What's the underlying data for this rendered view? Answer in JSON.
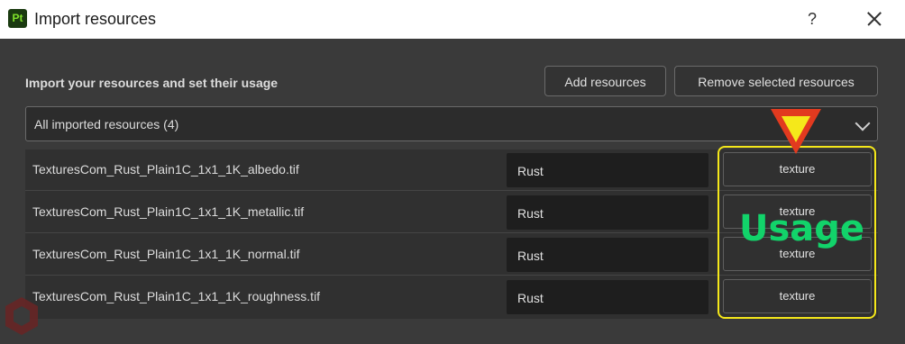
{
  "window": {
    "app_icon_text": "Pt",
    "title": "Import resources",
    "help_label": "?"
  },
  "header": {
    "heading": "Import your resources and set their usage",
    "add_button": "Add resources",
    "remove_button": "Remove selected resources"
  },
  "filter": {
    "selected": "All imported resources (4)"
  },
  "resources": [
    {
      "name": "TexturesCom_Rust_Plain1C_1x1_1K_albedo.tif",
      "category": "Rust",
      "usage": "texture"
    },
    {
      "name": "TexturesCom_Rust_Plain1C_1x1_1K_metallic.tif",
      "category": "Rust",
      "usage": "texture"
    },
    {
      "name": "TexturesCom_Rust_Plain1C_1x1_1K_normal.tif",
      "category": "Rust",
      "usage": "texture"
    },
    {
      "name": "TexturesCom_Rust_Plain1C_1x1_1K_roughness.tif",
      "category": "Rust",
      "usage": "texture"
    }
  ],
  "annotation": {
    "label": "Usage",
    "highlight_color": "#f5e81a",
    "arrow_color": "#e23a1f",
    "label_color": "#12d36a"
  }
}
